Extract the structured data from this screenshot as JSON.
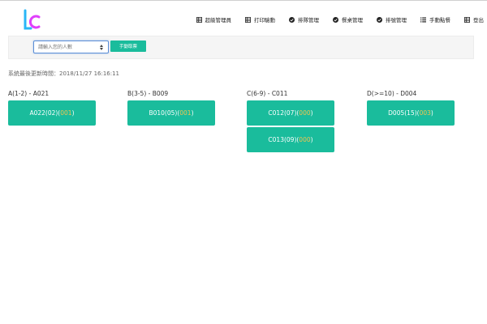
{
  "nav": {
    "items": [
      {
        "label": "超級管理員",
        "icon": "table-icon"
      },
      {
        "label": "打印驗動",
        "icon": "table-icon"
      },
      {
        "label": "排隊管理",
        "icon": "check-circle-icon"
      },
      {
        "label": "餐桌管理",
        "icon": "check-circle-icon"
      },
      {
        "label": "排號管理",
        "icon": "check-circle-icon"
      },
      {
        "label": "手動點餐",
        "icon": "list-icon"
      },
      {
        "label": "登出",
        "icon": "table-icon"
      }
    ]
  },
  "filter": {
    "placeholder": "請輸入您的人數",
    "button_label": "手動取票"
  },
  "last_update": "系統最後更新時間：2018/11/27 16:16:11",
  "colors": {
    "accent": "#1abc9c",
    "wait_number": "#f0c451"
  },
  "groups": [
    {
      "title": "A(1-2) - A021",
      "tickets": [
        {
          "code": "A022(02)(",
          "wait": "001",
          "close": ")"
        }
      ]
    },
    {
      "title": "B(3-5) - B009",
      "tickets": [
        {
          "code": "B010(05)(",
          "wait": "001",
          "close": ")"
        }
      ]
    },
    {
      "title": "C(6-9) - C011",
      "tickets": [
        {
          "code": "C012(07)(",
          "wait": "000",
          "close": ")"
        },
        {
          "code": "C013(09)(",
          "wait": "000",
          "close": ")"
        }
      ]
    },
    {
      "title": "D(>=10) - D004",
      "tickets": [
        {
          "code": "D005(15)(",
          "wait": "003",
          "close": ")"
        }
      ]
    }
  ]
}
